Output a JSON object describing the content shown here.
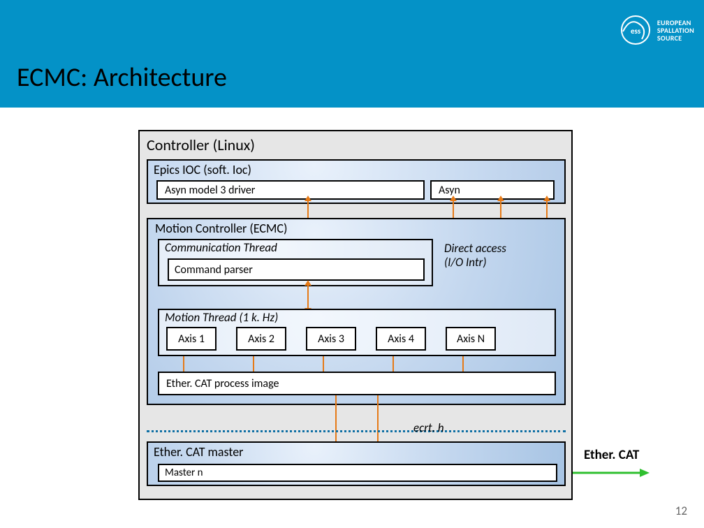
{
  "header": {
    "title": "ECMC: Architecture",
    "brand_line1": "EUROPEAN",
    "brand_line2": "SPALLATION",
    "brand_line3": "SOURCE",
    "brand_short": "ess"
  },
  "diagram": {
    "controller_label": "Controller (Linux)",
    "ioc": {
      "label": "Epics IOC (soft. Ioc)",
      "asyn_driver": "Asyn model 3 driver",
      "asyn": "Asyn"
    },
    "ecmc": {
      "label": "Motion Controller (ECMC)",
      "comm_thread": "Communication Thread",
      "command_parser": "Command parser",
      "direct_access_l1": "Direct access",
      "direct_access_l2": "(I/O Intr)",
      "motion_thread": "Motion Thread  (1 k. Hz)",
      "axes": [
        "Axis 1",
        "Axis 2",
        "Axis 3",
        "Axis 4",
        "Axis N"
      ],
      "process_image": "Ether. CAT process image"
    },
    "ecrt": "ecrt. h",
    "master": {
      "label": "Ether. CAT master",
      "sub": "Master n"
    },
    "ethercat_external": "Ether. CAT"
  },
  "page_number": "12"
}
